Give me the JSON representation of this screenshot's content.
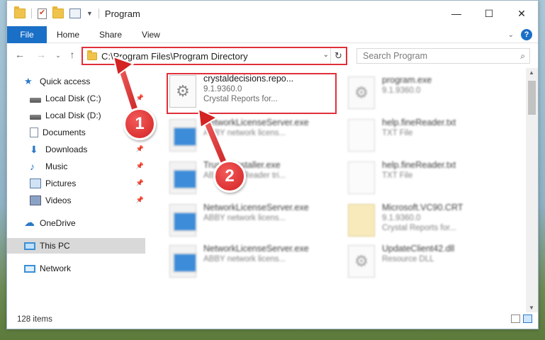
{
  "window": {
    "title": "Program",
    "controls": {
      "minimize": "—",
      "maximize": "☐",
      "close": "✕"
    }
  },
  "ribbon": {
    "tabs": [
      "File",
      "Home",
      "Share",
      "View"
    ],
    "help": "?"
  },
  "address": {
    "path": "C:\\Program Files\\Program Directory",
    "search_placeholder": "Search Program"
  },
  "sidebar": {
    "items": [
      {
        "label": "Quick access",
        "icon": "star-icon",
        "pinned": false
      },
      {
        "label": "Local Disk (C:)",
        "icon": "disk-icon",
        "pinned": true
      },
      {
        "label": "Local Disk (D:)",
        "icon": "disk-icon",
        "pinned": false
      },
      {
        "label": "Documents",
        "icon": "document-icon",
        "pinned": true
      },
      {
        "label": "Downloads",
        "icon": "download-icon",
        "pinned": true
      },
      {
        "label": "Music",
        "icon": "music-icon",
        "pinned": true
      },
      {
        "label": "Pictures",
        "icon": "picture-icon",
        "pinned": true
      },
      {
        "label": "Videos",
        "icon": "video-icon",
        "pinned": true
      },
      {
        "label": "OneDrive",
        "icon": "cloud-icon",
        "pinned": false
      },
      {
        "label": "This PC",
        "icon": "pc-icon",
        "pinned": false,
        "selected": true
      },
      {
        "label": "Network",
        "icon": "network-icon",
        "pinned": false
      }
    ]
  },
  "files": [
    {
      "name": "crystaldecisions.repo...",
      "line2": "9.1.9360.0",
      "line3": "Crystal Reports for...",
      "icon": "gear-icon",
      "highlighted": true
    },
    {
      "name": "program.exe",
      "line2": "9.1.9360.0",
      "icon": "exe-icon"
    },
    {
      "name": "NetworkLicenseServer.exe",
      "line2": "ABBY network licens...",
      "icon": "exe-icon"
    },
    {
      "name": "help.fineReader.txt",
      "line2": "TXT File",
      "icon": "txt-icon"
    },
    {
      "name": "TrustedInstaller.exe",
      "line2": "ABBY FineReader tri...",
      "icon": "exe-icon"
    },
    {
      "name": "help.fineReader.txt",
      "line2": "TXT File",
      "icon": "txt-icon"
    },
    {
      "name": "NetworkLicenseServer.exe",
      "line2": "ABBY network licens...",
      "icon": "exe-icon"
    },
    {
      "name": "Microsoft.VC90.CRT",
      "line2": "9.1.9360.0",
      "line3": "Crystal Reports for...",
      "icon": "certificate-icon"
    },
    {
      "name": "NetworkLicenseServer.exe",
      "line2": "ABBY network licens...",
      "icon": "exe-icon"
    },
    {
      "name": "UpdateClient42.dll",
      "line2": "Resource DLL",
      "icon": "dll-icon"
    }
  ],
  "status": {
    "count": "128 items"
  },
  "callouts": {
    "one": "1",
    "two": "2"
  },
  "colors": {
    "accent": "#1a6fc7",
    "highlight": "#e0303a",
    "callout": "#d32323"
  }
}
